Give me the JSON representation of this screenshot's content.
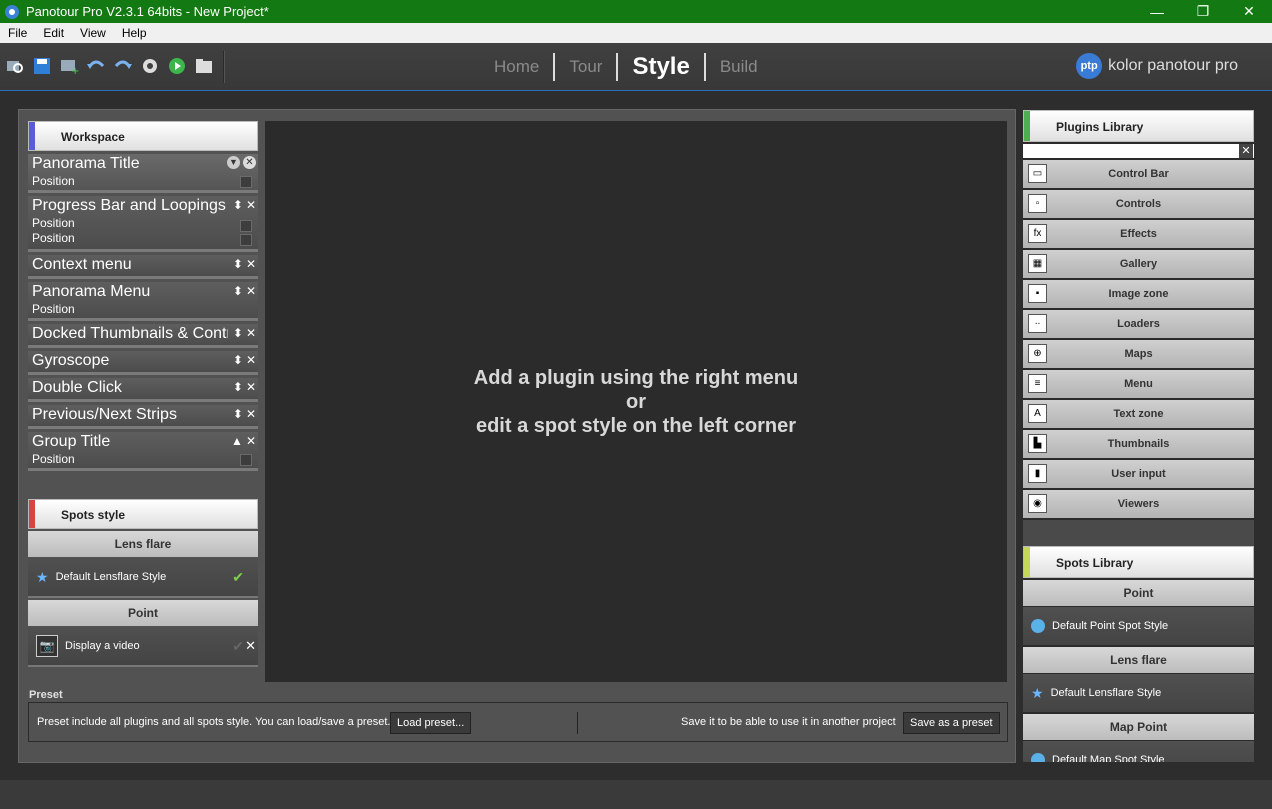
{
  "window": {
    "title": "Panotour Pro V2.3.1 64bits - New Project*",
    "minimize": "—",
    "maximize": "❐",
    "close": "✕"
  },
  "menu": [
    "File",
    "Edit",
    "View",
    "Help"
  ],
  "nav": {
    "home": "Home",
    "tour": "Tour",
    "style": "Style",
    "build": "Build"
  },
  "brand": {
    "logo": "ptp",
    "text": "kolor panotour pro"
  },
  "workspace": {
    "title": "Workspace",
    "stripe_color": "#5b5bd6",
    "items": [
      {
        "name": "Panorama Title",
        "subs": [
          "Position"
        ]
      },
      {
        "name": "Progress Bar and Loopings",
        "subs": [
          "Position",
          "Position"
        ]
      },
      {
        "name": "Context menu",
        "subs": []
      },
      {
        "name": "Panorama Menu",
        "subs": [
          "Position"
        ]
      },
      {
        "name": "Docked Thumbnails & Contro",
        "subs": []
      },
      {
        "name": "Gyroscope",
        "subs": []
      },
      {
        "name": "Double Click",
        "subs": []
      },
      {
        "name": "Previous/Next Strips",
        "subs": []
      },
      {
        "name": "Group Title",
        "subs": [
          "Position"
        ]
      }
    ]
  },
  "spots_style": {
    "title": "Spots style",
    "stripe_color": "#d64545",
    "lens_flare": "Lens flare",
    "lens_item": "Default Lensflare Style",
    "point": "Point",
    "point_item": "Display a video"
  },
  "canvas": {
    "line1": "Add a plugin using the right menu",
    "line2": "or",
    "line3": "edit a spot style on the left corner"
  },
  "preset": {
    "label": "Preset",
    "info": "Preset include all plugins and all spots style. You can load/save a preset.",
    "load": "Load preset...",
    "save_info": "Save it to be able to use it in another project",
    "save": "Save as a preset"
  },
  "plugins_library": {
    "title": "Plugins Library",
    "stripe_color": "#4caf50",
    "items": [
      {
        "label": "Control Bar",
        "icon": "control-bar-icon",
        "glyph": "▭"
      },
      {
        "label": "Controls",
        "icon": "controls-icon",
        "glyph": "▫"
      },
      {
        "label": "Effects",
        "icon": "effects-icon",
        "glyph": "fx"
      },
      {
        "label": "Gallery",
        "icon": "gallery-icon",
        "glyph": "▦"
      },
      {
        "label": "Image zone",
        "icon": "image-zone-icon",
        "glyph": "▪"
      },
      {
        "label": "Loaders",
        "icon": "loaders-icon",
        "glyph": "∙∙"
      },
      {
        "label": "Maps",
        "icon": "maps-icon",
        "glyph": "⊕"
      },
      {
        "label": "Menu",
        "icon": "menu-icon",
        "glyph": "≡"
      },
      {
        "label": "Text zone",
        "icon": "text-zone-icon",
        "glyph": "A"
      },
      {
        "label": "Thumbnails",
        "icon": "thumbnails-icon",
        "glyph": "▙"
      },
      {
        "label": "User input",
        "icon": "user-input-icon",
        "glyph": "▮"
      },
      {
        "label": "Viewers",
        "icon": "viewers-icon",
        "glyph": "◉"
      }
    ]
  },
  "spots_library": {
    "title": "Spots Library",
    "stripe_color": "#c6d65b",
    "point": "Point",
    "point_item": "Default Point Spot Style",
    "lens_flare": "Lens flare",
    "lens_item": "Default Lensflare Style",
    "map_point": "Map Point",
    "map_item": "Default Map Spot Style"
  }
}
